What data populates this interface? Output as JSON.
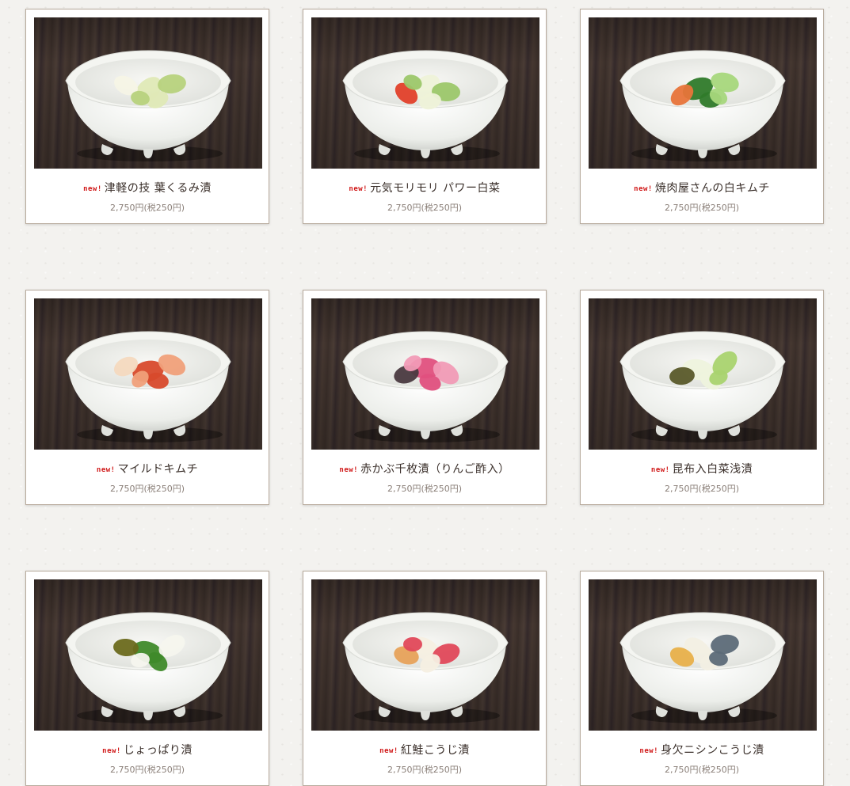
{
  "products": [
    {
      "badge": "new!",
      "name": "津軽の技 葉くるみ漬",
      "price": "2,750円(税250円)",
      "photo_icon": "cabbage-pickle-bowl",
      "colors": [
        "#dfe9b6",
        "#b7d27d",
        "#f5f4e6"
      ]
    },
    {
      "badge": "new!",
      "name": "元気モリモリ パワー白菜",
      "price": "2,750円(税250円)",
      "photo_icon": "napa-cabbage-bowl",
      "colors": [
        "#eef2d8",
        "#9cc76a",
        "#e2402a"
      ]
    },
    {
      "badge": "new!",
      "name": "焼肉屋さんの白キムチ",
      "price": "2,750円(税250円)",
      "photo_icon": "cucumber-kimchi-bowl",
      "colors": [
        "#2f7a2a",
        "#a6d77c",
        "#e8743a"
      ]
    },
    {
      "badge": "new!",
      "name": "マイルドキムチ",
      "price": "2,750円(税250円)",
      "photo_icon": "kimchi-bowl",
      "colors": [
        "#d84a2c",
        "#f0a07a",
        "#f4d9bf"
      ]
    },
    {
      "badge": "new!",
      "name": "赤かぶ千枚漬（りんご酢入）",
      "price": "2,750円(税250円)",
      "photo_icon": "red-turnip-bowl",
      "colors": [
        "#e0507e",
        "#f19bb6",
        "#4a3a40"
      ]
    },
    {
      "badge": "new!",
      "name": "昆布入白菜浅漬",
      "price": "2,750円(税250円)",
      "photo_icon": "napa-kombu-bowl",
      "colors": [
        "#eef3dd",
        "#a9d36f",
        "#5a5a2a"
      ]
    },
    {
      "badge": "new!",
      "name": "じょっぱり漬",
      "price": "2,750円(税250円)",
      "photo_icon": "mixed-pickle-bowl",
      "colors": [
        "#3f8a2a",
        "#f6f6ee",
        "#6b6a1e"
      ]
    },
    {
      "badge": "new!",
      "name": "紅鮭こうじ漬",
      "price": "2,750円(税250円)",
      "photo_icon": "salmon-koji-bowl",
      "colors": [
        "#f5efe2",
        "#e0485a",
        "#e7a25a"
      ]
    },
    {
      "badge": "new!",
      "name": "身欠ニシンこうじ漬",
      "price": "2,750円(税250円)",
      "photo_icon": "herring-koji-bowl",
      "colors": [
        "#f2efe3",
        "#5c6a78",
        "#e8b04a"
      ]
    }
  ]
}
